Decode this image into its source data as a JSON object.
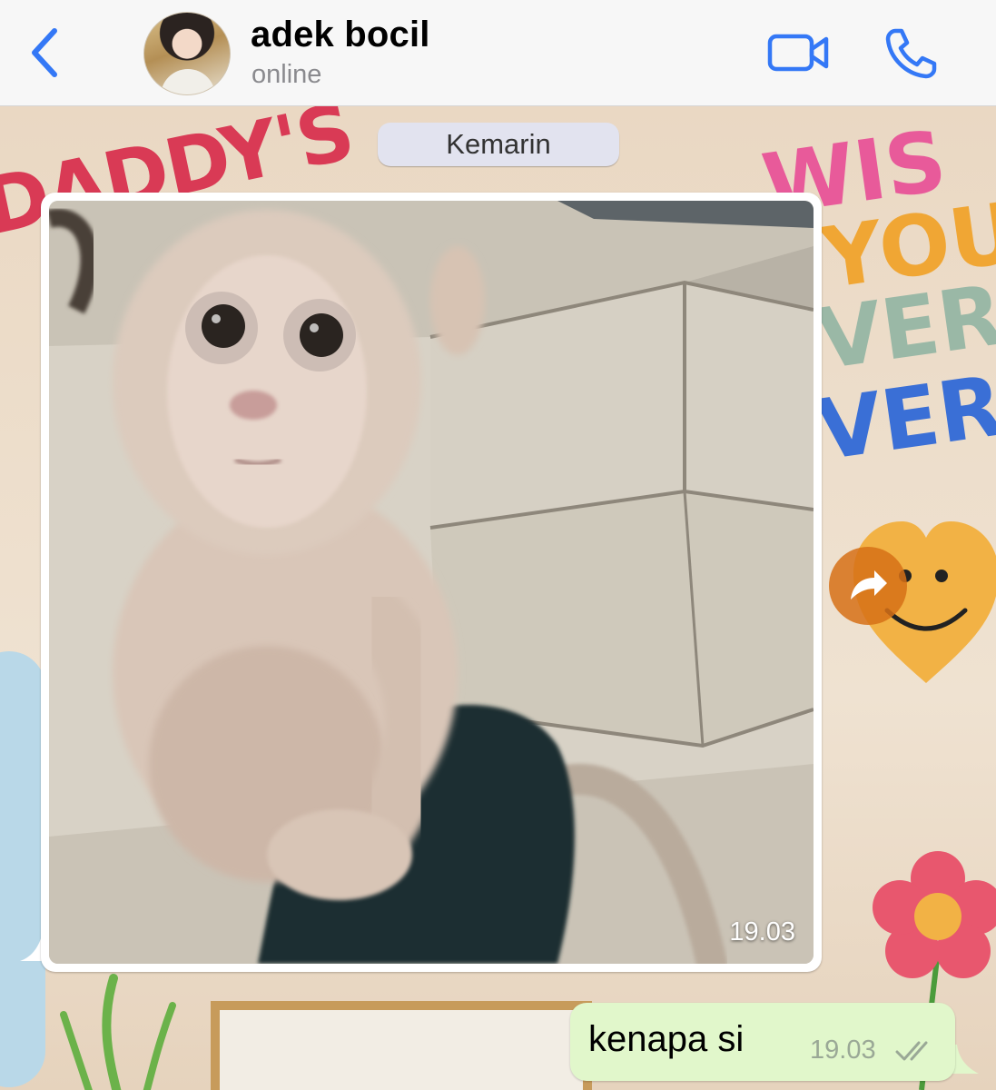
{
  "header": {
    "contact_name": "adek bocil",
    "status": "online",
    "accent_color": "#3478f6"
  },
  "chat": {
    "date_separator": "Kemarin",
    "messages": [
      {
        "direction": "incoming",
        "type": "image",
        "image_description_icon": "monkey-photo",
        "time": "19.03"
      },
      {
        "direction": "outgoing",
        "type": "text",
        "text": "kenapa si",
        "time": "19.03",
        "status_icon": "double-check-icon"
      }
    ]
  },
  "colors": {
    "outgoing_bubble": "#e1f7cb",
    "incoming_bubble": "#ffffff",
    "forward_button": "#d67016"
  }
}
